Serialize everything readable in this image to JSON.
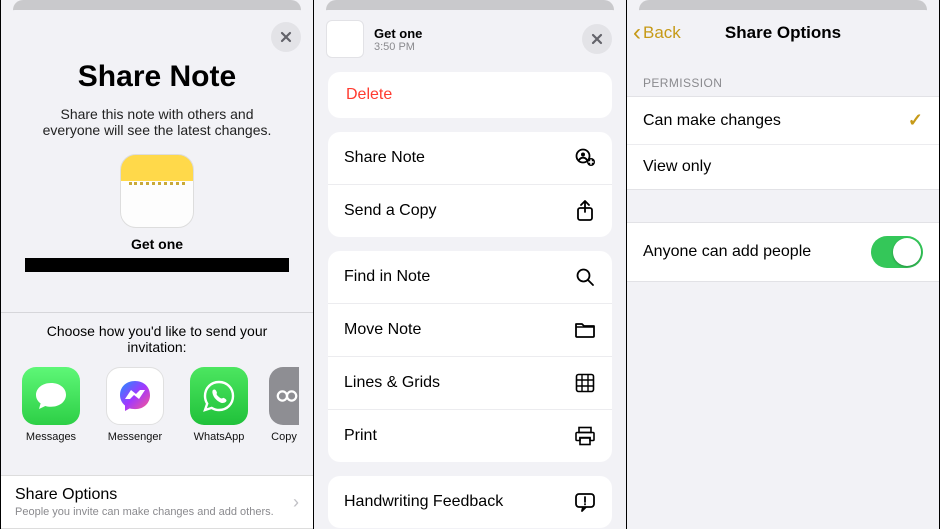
{
  "panel1": {
    "title": "Share Note",
    "subtitle": "Share this note with others and everyone will see the latest changes.",
    "note_title": "Get one",
    "choose_text": "Choose how you'd like to send your invitation:",
    "apps": {
      "messages": "Messages",
      "messenger": "Messenger",
      "whatsapp": "WhatsApp",
      "copy": "Copy"
    },
    "share_options": {
      "title": "Share Options",
      "subtitle": "People you invite can make changes and add others."
    }
  },
  "panel2": {
    "header": {
      "title": "Get one",
      "timestamp": "3:50 PM"
    },
    "delete": "Delete",
    "group1": {
      "share_note": "Share Note",
      "send_copy": "Send a Copy"
    },
    "group2": {
      "find": "Find in Note",
      "move": "Move Note",
      "lines": "Lines & Grids",
      "print": "Print"
    },
    "group3": {
      "handwriting": "Handwriting Feedback"
    }
  },
  "panel3": {
    "back": "Back",
    "title": "Share Options",
    "section_label": "PERMISSION",
    "perm": {
      "can_change": "Can make changes",
      "view_only": "View only"
    },
    "anyone": "Anyone can add people"
  }
}
